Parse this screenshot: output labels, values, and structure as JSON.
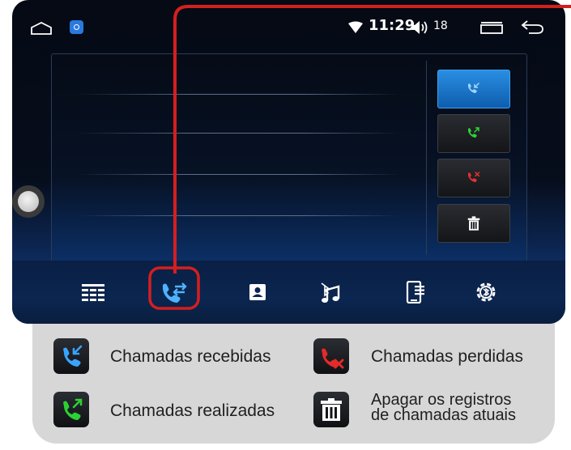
{
  "status_bar": {
    "time": "11:29",
    "volume": "18",
    "icons": [
      "home-icon",
      "app-badge-icon",
      "wifi-icon",
      "volume-icon",
      "recent-apps-icon",
      "back-icon"
    ]
  },
  "side_buttons": [
    {
      "name": "received-calls-button",
      "icon": "call-received-icon",
      "active": true
    },
    {
      "name": "dialed-calls-button",
      "icon": "call-made-icon",
      "active": false
    },
    {
      "name": "missed-calls-button",
      "icon": "call-missed-icon",
      "active": false
    },
    {
      "name": "delete-records-button",
      "icon": "trash-icon",
      "active": false
    }
  ],
  "nav_items": [
    {
      "name": "dialpad",
      "icon": "dialpad-icon"
    },
    {
      "name": "call-log",
      "icon": "call-log-icon",
      "active": true
    },
    {
      "name": "contacts",
      "icon": "contacts-icon"
    },
    {
      "name": "bluetooth-music",
      "icon": "bt-music-icon"
    },
    {
      "name": "phone-device",
      "icon": "phone-device-icon"
    },
    {
      "name": "bluetooth-settings",
      "icon": "bt-settings-icon"
    }
  ],
  "legend": {
    "received": "Chamadas recebidas",
    "missed": "Chamadas perdidas",
    "dialed": "Chamadas realizadas",
    "delete_line1": "Apagar os registros",
    "delete_line2": "de chamadas atuais"
  },
  "colors": {
    "accent_blue": "#1e88e5",
    "call_green": "#22c72a",
    "call_red": "#e02020",
    "highlight_red": "#d41f1f",
    "legend_bg": "#d7d7d7"
  }
}
